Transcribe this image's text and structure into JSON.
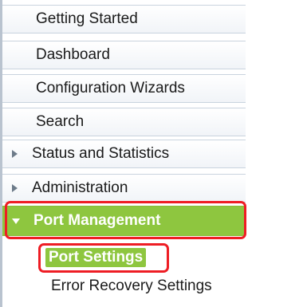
{
  "nav": {
    "items": [
      {
        "label": "Getting Started"
      },
      {
        "label": "Dashboard"
      },
      {
        "label": "Configuration Wizards"
      },
      {
        "label": "Search"
      },
      {
        "label": "Status and Statistics"
      },
      {
        "label": "Administration"
      },
      {
        "label": "Port Management"
      }
    ],
    "subitems": [
      {
        "label": "Port Settings",
        "selected": true
      },
      {
        "label": "Error Recovery Settings",
        "selected": false
      }
    ]
  },
  "colors": {
    "active_bg": "#8ec63f",
    "highlight": "#ee1d24",
    "border": "#c9d3de"
  }
}
